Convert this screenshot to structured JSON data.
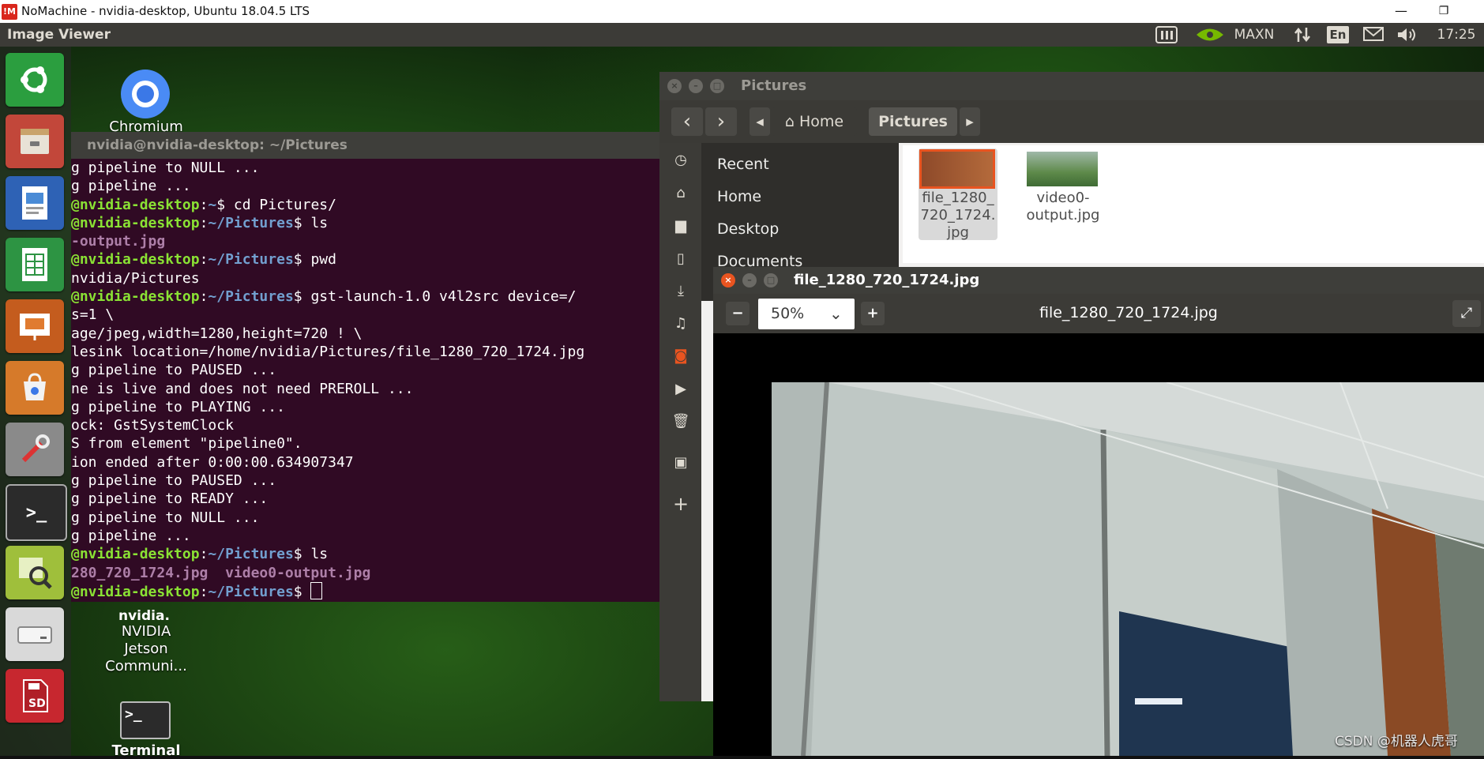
{
  "host": {
    "logo": "!M",
    "title": "NoMachine - nvidia-desktop, Ubuntu 18.04.5 LTS",
    "minimize": "—",
    "restore": "❐"
  },
  "panel": {
    "app_name": "Image Viewer",
    "power_mode": "MAXN",
    "keyboard": "En",
    "time": "17:25"
  },
  "desktop": {
    "chromium_label": "Chromium",
    "nvidia_logo": "nvidia.",
    "nvidia_label_1": "NVIDIA",
    "nvidia_label_2": "Jetson",
    "nvidia_label_3": "Communi...",
    "terminal_label": "Terminal"
  },
  "terminal": {
    "title": "nvidia@nvidia-desktop: ~/Pictures",
    "lines": [
      {
        "plain": "g pipeline to NULL ..."
      },
      {
        "plain": "g pipeline ..."
      },
      {
        "user": "@nvidia-desktop",
        "path": "~",
        "cmd": "$ cd Pictures/"
      },
      {
        "user": "@nvidia-desktop",
        "path": "~/Pictures",
        "cmd": "$ ls"
      },
      {
        "purple": "-output.jpg"
      },
      {
        "user": "@nvidia-desktop",
        "path": "~/Pictures",
        "cmd": "$ pwd"
      },
      {
        "plain": "nvidia/Pictures"
      },
      {
        "user": "@nvidia-desktop",
        "path": "~/Pictures",
        "cmd": "$ gst-launch-1.0 v4l2src device=/"
      },
      {
        "plain": "s=1 \\"
      },
      {
        "plain": "age/jpeg,width=1280,height=720 ! \\"
      },
      {
        "plain": "lesink location=/home/nvidia/Pictures/file_1280_720_1724.jpg"
      },
      {
        "plain": "g pipeline to PAUSED ..."
      },
      {
        "plain": "ne is live and does not need PREROLL ..."
      },
      {
        "plain": "g pipeline to PLAYING ..."
      },
      {
        "plain": "ock: GstSystemClock"
      },
      {
        "plain": "S from element \"pipeline0\"."
      },
      {
        "plain": "ion ended after 0:00:00.634907347"
      },
      {
        "plain": "g pipeline to PAUSED ..."
      },
      {
        "plain": "g pipeline to READY ..."
      },
      {
        "plain": "g pipeline to NULL ..."
      },
      {
        "plain": "g pipeline ..."
      },
      {
        "user": "@nvidia-desktop",
        "path": "~/Pictures",
        "cmd": "$ ls"
      },
      {
        "purple": "280_720_1724.jpg  video0-output.jpg"
      },
      {
        "user": "@nvidia-desktop",
        "path": "~/Pictures",
        "cmd": "$ ",
        "cursor": true
      }
    ]
  },
  "files": {
    "title": "Pictures",
    "back": "‹",
    "forward": "›",
    "crumb_prev": "◂",
    "crumb_home": "Home",
    "crumb_current": "Pictures",
    "crumb_next": "▸",
    "places": [
      "Recent",
      "Home",
      "Desktop",
      "Documents"
    ],
    "items": [
      {
        "name_l1": "file_1280_",
        "name_l2": "720_1724.",
        "name_l3": "jpg"
      },
      {
        "name_l1": "video0-",
        "name_l2": "output.jpg"
      }
    ]
  },
  "viewer": {
    "title": "file_1280_720_1724.jpg",
    "zoom": "50%",
    "zoom_out": "−",
    "zoom_in": "+",
    "filename": "file_1280_720_1724.jpg"
  },
  "watermark": "CSDN @机器人虎哥",
  "colors": {
    "terminal_bg": "#300a24",
    "prompt_green": "#8ae234",
    "prompt_blue": "#729fcf",
    "panel_bg": "#3c3b37",
    "nvidia_green": "#76b900"
  }
}
